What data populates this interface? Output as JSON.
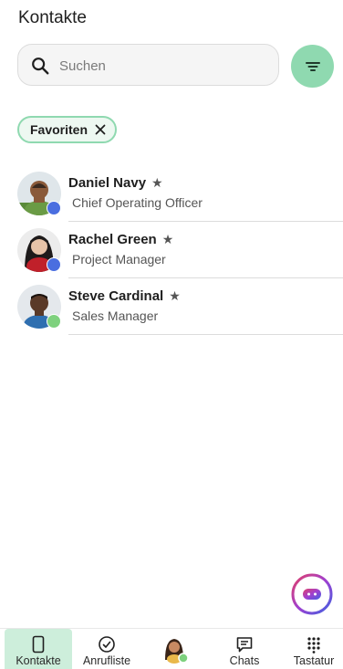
{
  "header": {
    "title": "Kontakte"
  },
  "search": {
    "placeholder": "Suchen",
    "icon": "search-icon"
  },
  "filter": {
    "icon": "filter-icon",
    "color": "#8fd9b0"
  },
  "chips": [
    {
      "label": "Favoriten",
      "icon": "close-icon"
    }
  ],
  "contacts": [
    {
      "name": "Daniel Navy",
      "role": "Chief Operating Officer",
      "favorite": true,
      "presence_color": "#4a6ee0"
    },
    {
      "name": "Rachel Green",
      "role": "Project Manager",
      "favorite": true,
      "presence_color": "#4a6ee0"
    },
    {
      "name": "Steve Cardinal",
      "role": "Sales Manager",
      "favorite": true,
      "presence_color": "#7ed17e"
    }
  ],
  "star_glyph": "★",
  "nav": {
    "items": [
      {
        "label": "Kontakte",
        "icon": "contacts-icon",
        "active": true
      },
      {
        "label": "Anrufliste",
        "icon": "call-history-icon",
        "active": false
      },
      {
        "label": "",
        "icon": "profile-avatar",
        "active": false
      },
      {
        "label": "Chats",
        "icon": "chat-icon",
        "active": false
      },
      {
        "label": "Tastatur",
        "icon": "dialpad-icon",
        "active": false
      }
    ],
    "active_color": "#cdeedb"
  },
  "fab": {
    "icon": "assistant-icon"
  }
}
